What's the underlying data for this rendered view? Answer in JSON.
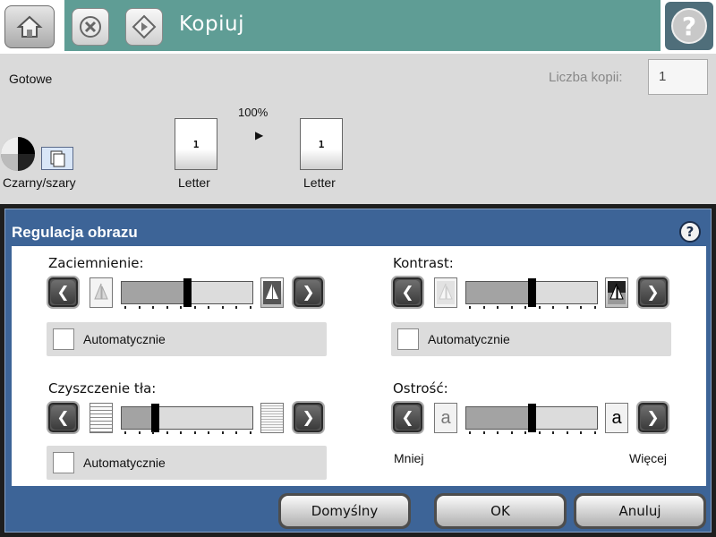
{
  "header": {
    "title": "Kopiuj",
    "help_symbol": "?"
  },
  "status": {
    "text": "Gotowe",
    "copies_label": "Liczba kopii:",
    "copies_value": "1"
  },
  "preview": {
    "color_mode": "Czarny/szary",
    "zoom": "100%",
    "input_page_count": "1",
    "input_size": "Letter",
    "output_page_count": "1",
    "output_size": "Letter"
  },
  "dialog": {
    "title": "Regulacja obrazu",
    "help_symbol": "?",
    "darkness": {
      "label": "Zaciemnienie:",
      "level": 0.5,
      "auto_label": "Automatycznie",
      "auto_checked": false
    },
    "contrast": {
      "label": "Kontrast:",
      "level": 0.5,
      "auto_label": "Automatycznie",
      "auto_checked": false
    },
    "background_cleanup": {
      "label": "Czyszczenie tła:",
      "level": 0.25,
      "auto_label": "Automatycznie",
      "auto_checked": false
    },
    "sharpness": {
      "label": "Ostrość:",
      "level": 0.5,
      "min_label": "Mniej",
      "max_label": "Więcej",
      "min_icon_text": "a",
      "max_icon_text": "a"
    },
    "buttons": {
      "default": "Domyślny",
      "ok": "OK",
      "cancel": "Anuluj"
    }
  },
  "colors": {
    "title_band": "#5f9d95",
    "dialog_blue": "#3d6497",
    "slider_fill": "#a3a3a3"
  },
  "icons": {
    "home": "home-icon",
    "stop": "stop-icon",
    "start": "start-icon",
    "help": "help-icon",
    "left_arrow": "chevron-left-icon",
    "right_arrow": "chevron-right-icon"
  }
}
